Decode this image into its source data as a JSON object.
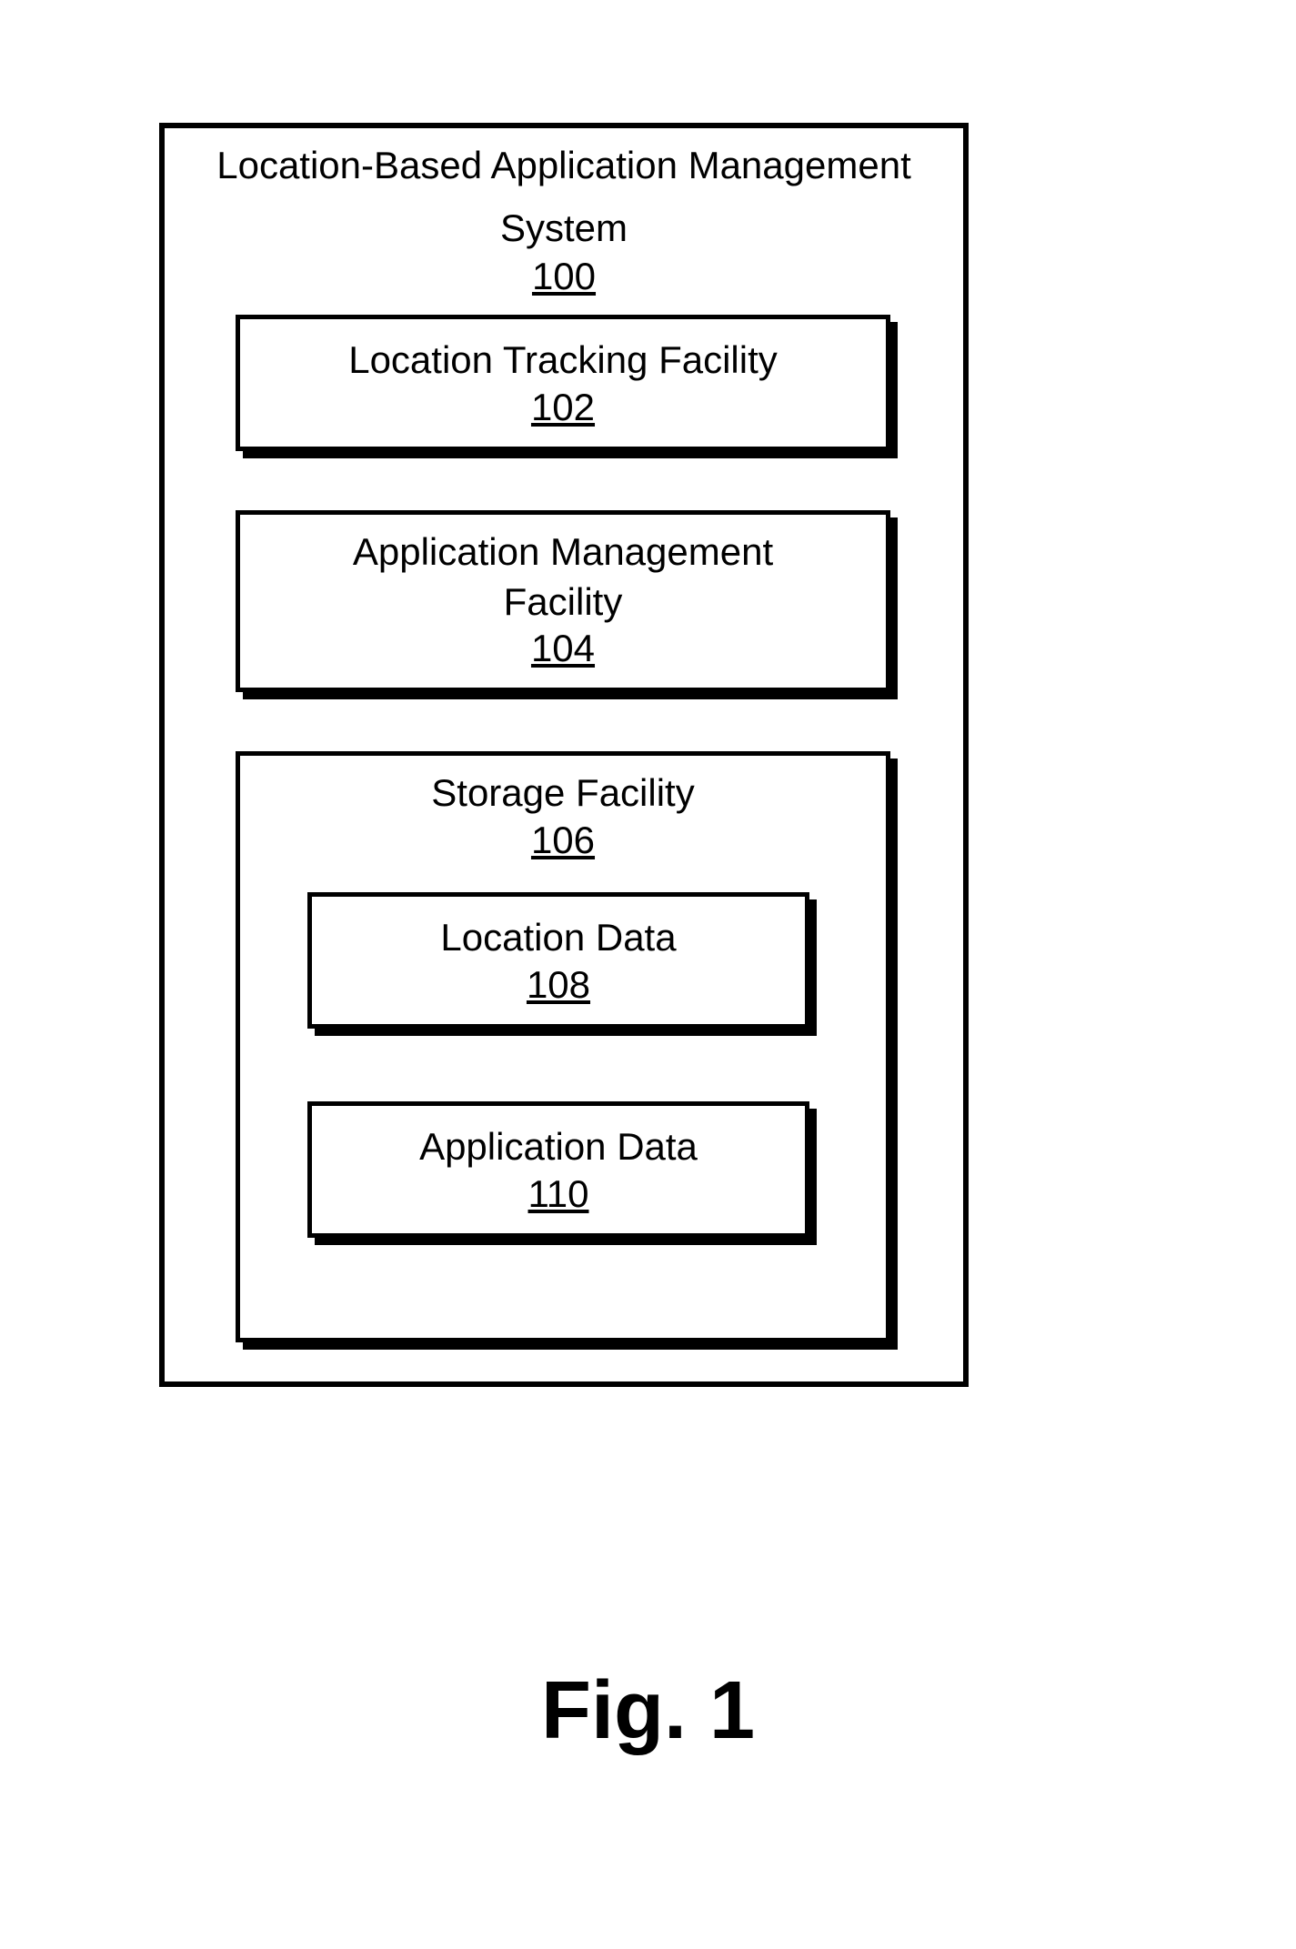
{
  "diagram": {
    "outer": {
      "title_line1": "Location-Based Application Management",
      "title_line2": "System",
      "ref": "100"
    },
    "box102": {
      "title": "Location Tracking Facility",
      "ref": "102"
    },
    "box104": {
      "title_line1": "Application Management",
      "title_line2": "Facility",
      "ref": "104"
    },
    "box106": {
      "title": "Storage Facility",
      "ref": "106"
    },
    "box108": {
      "title": "Location Data",
      "ref": "108"
    },
    "box110": {
      "title": "Application Data",
      "ref": "110"
    }
  },
  "figure_label": "Fig. 1"
}
